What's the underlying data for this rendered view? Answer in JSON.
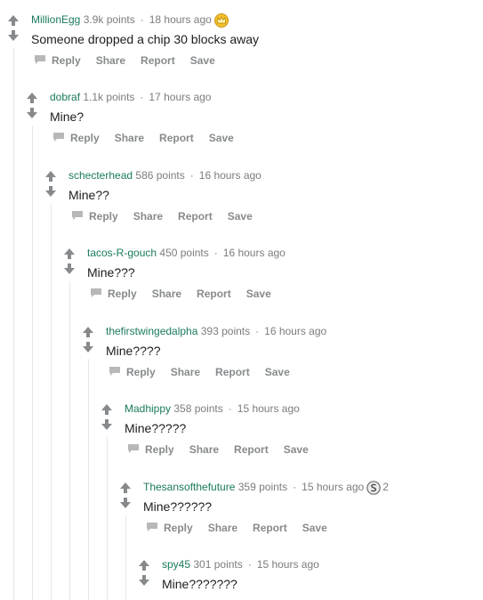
{
  "actions": {
    "reply": "Reply",
    "share": "Share",
    "report": "Report",
    "save": "Save"
  },
  "comments": [
    {
      "author": "MillionEgg",
      "points": "3.9k points",
      "time": "18 hours ago",
      "body": "Someone dropped a chip 30 blocks away",
      "award": "gold-crown-award",
      "award_count": ""
    },
    {
      "author": "dobraf",
      "points": "1.1k points",
      "time": "17 hours ago",
      "body": "Mine?",
      "award": "",
      "award_count": ""
    },
    {
      "author": "schecterhead",
      "points": "586 points",
      "time": "16 hours ago",
      "body": "Mine??",
      "award": "",
      "award_count": ""
    },
    {
      "author": "tacos-R-gouch",
      "points": "450 points",
      "time": "16 hours ago",
      "body": "Mine???",
      "award": "",
      "award_count": ""
    },
    {
      "author": "thefirstwingedalpha",
      "points": "393 points",
      "time": "16 hours ago",
      "body": "Mine????",
      "award": "",
      "award_count": ""
    },
    {
      "author": "Madhippy",
      "points": "358 points",
      "time": "15 hours ago",
      "body": "Mine?????",
      "award": "",
      "award_count": ""
    },
    {
      "author": "Thesansofthefuture",
      "points": "359 points",
      "time": "15 hours ago",
      "body": "Mine??????",
      "award": "silver-award",
      "award_count": "2"
    },
    {
      "author": "spy45",
      "points": "301 points",
      "time": "15 hours ago",
      "body": "Mine???????",
      "award": "",
      "award_count": ""
    }
  ],
  "colors": {
    "author": "#1a7a5e",
    "meta": "#7c7c7c",
    "action": "#878a8c",
    "thread_line": "#e6e6e6",
    "arrow": "#878a8c"
  }
}
